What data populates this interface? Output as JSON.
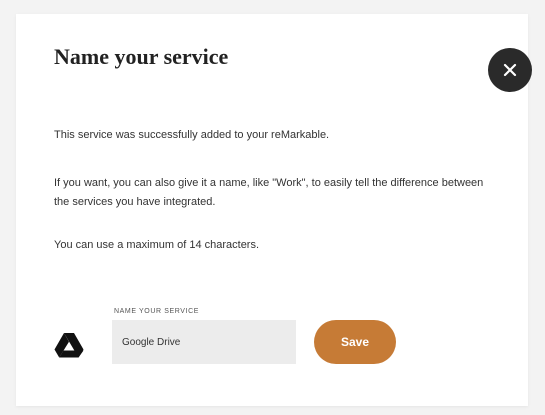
{
  "dialog": {
    "title": "Name your service",
    "close_icon": "close-icon",
    "paragraphs": {
      "success": "This service was successfully added to your reMarkable.",
      "hint": "If you want, you can also give it a name, like \"Work\", to easily tell the difference between the services you have integrated.",
      "limit": "You can use a maximum of 14 characters."
    },
    "service_icon": "google-drive-icon",
    "field": {
      "label": "NAME YOUR SERVICE",
      "value": "Google Drive"
    },
    "save_label": "Save"
  },
  "colors": {
    "accent": "#c67b36",
    "close_button": "#2a2a2a",
    "input_background": "#ececec",
    "page_background": "#f3f3f3"
  }
}
